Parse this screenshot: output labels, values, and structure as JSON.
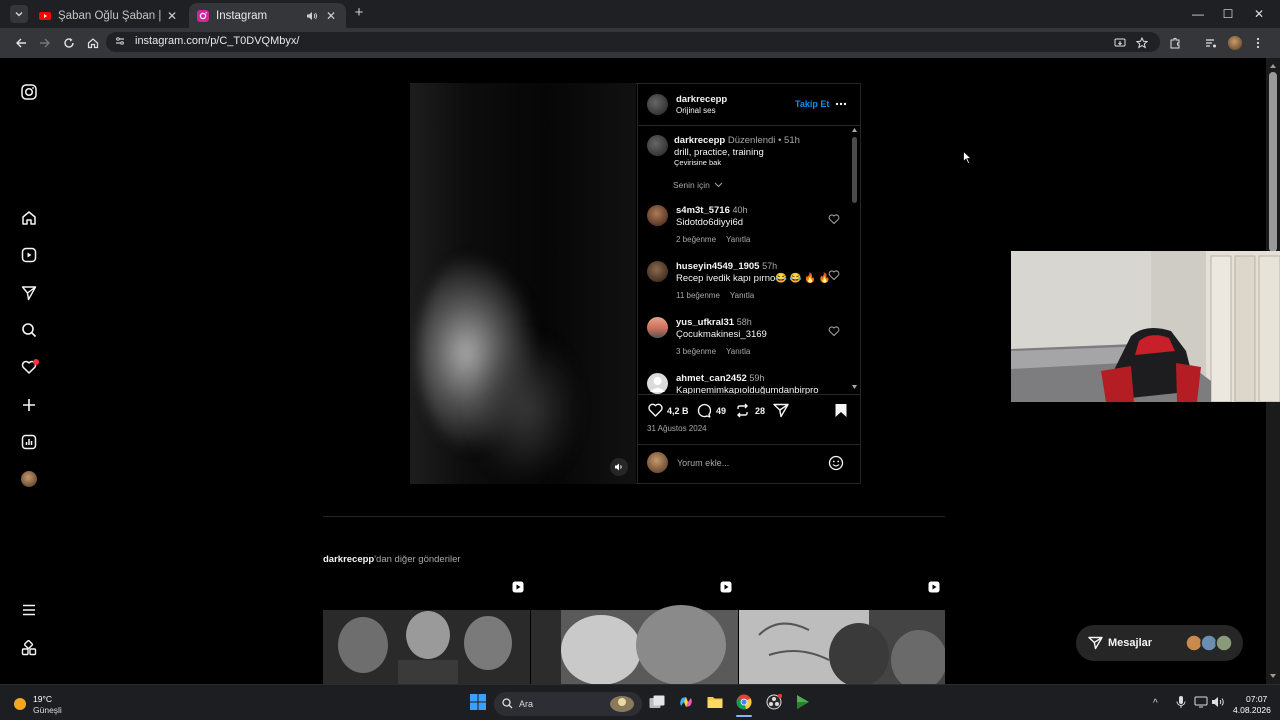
{
  "browser": {
    "tabs": [
      {
        "title": "Şaban Oğlu Şaban | FULL HD - Y",
        "active": false
      },
      {
        "title": "Instagram",
        "active": true
      }
    ],
    "url": "instagram.com/p/C_T0DVQMbyx/"
  },
  "post": {
    "author": "darkrecepp",
    "audio": "Orijinal ses",
    "follow_label": "Takip Et",
    "caption": {
      "author": "darkrecepp",
      "edited": "Düzenlendi",
      "time": "51h",
      "text": "drill, practice, training",
      "translate": "Çevirisine bak"
    },
    "sort_label": "Senin için",
    "comments": [
      {
        "user": "s4m3t_5716",
        "time": "40h",
        "text": "Sidotdo6diyyi6d",
        "likes": "2 beğenme",
        "reply": "Yanıtla"
      },
      {
        "user": "huseyin4549_1905",
        "time": "57h",
        "text": "Recep ivedik kapı pırno😂 😂 🔥 🔥",
        "likes": "11 beğenme",
        "reply": "Yanıtla"
      },
      {
        "user": "yus_ufkral31",
        "time": "58h",
        "text": "Çocukmakinesi_3169",
        "likes": "3 beğenme",
        "reply": "Yanıtla"
      },
      {
        "user": "ahmet_can2452",
        "time": "59h",
        "text": "Kapınemimkapıolduğumdanbirpro",
        "likes": "",
        "reply": ""
      }
    ],
    "stats": {
      "likes": "4,2 B",
      "comments": "49",
      "reposts": "28"
    },
    "date": "31 Ağustos 2024",
    "comment_placeholder": "Yorum ekle..."
  },
  "more_posts": {
    "user": "darkrecepp",
    "suffix": "'dan diğer gönderiler"
  },
  "messages_label": "Mesajlar",
  "taskbar": {
    "weather_temp": "19°C",
    "weather_desc": "Güneşli",
    "search_label": "Ara",
    "time": "07:07",
    "date": "4.08.2026"
  },
  "colors": {
    "accent": "#0095f6",
    "notif": "#ff3040",
    "bg": "#000000"
  }
}
